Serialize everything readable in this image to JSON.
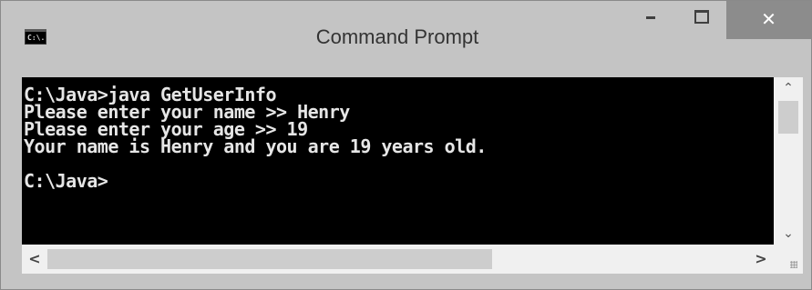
{
  "window": {
    "title": "Command Prompt",
    "icon": "console-icon",
    "icon_label": "C:\\.",
    "controls": {
      "minimize": "minimize-icon",
      "maximize": "maximize-icon",
      "close_label": "✕"
    }
  },
  "console": {
    "lines": [
      "C:\\Java>java GetUserInfo",
      "Please enter your name >> Henry",
      "Please enter your age >> 19",
      "Your name is Henry and you are 19 years old.",
      "",
      "C:\\Java>"
    ]
  },
  "scrollbars": {
    "up_arrow": "⌃",
    "down_arrow": "⌄",
    "left_arrow": "<",
    "right_arrow": ">"
  },
  "colors": {
    "console_background": "#000000",
    "console_text": "#e6e6e6",
    "frame": "#c4c4c4",
    "close_button": "#8c8c8c"
  }
}
